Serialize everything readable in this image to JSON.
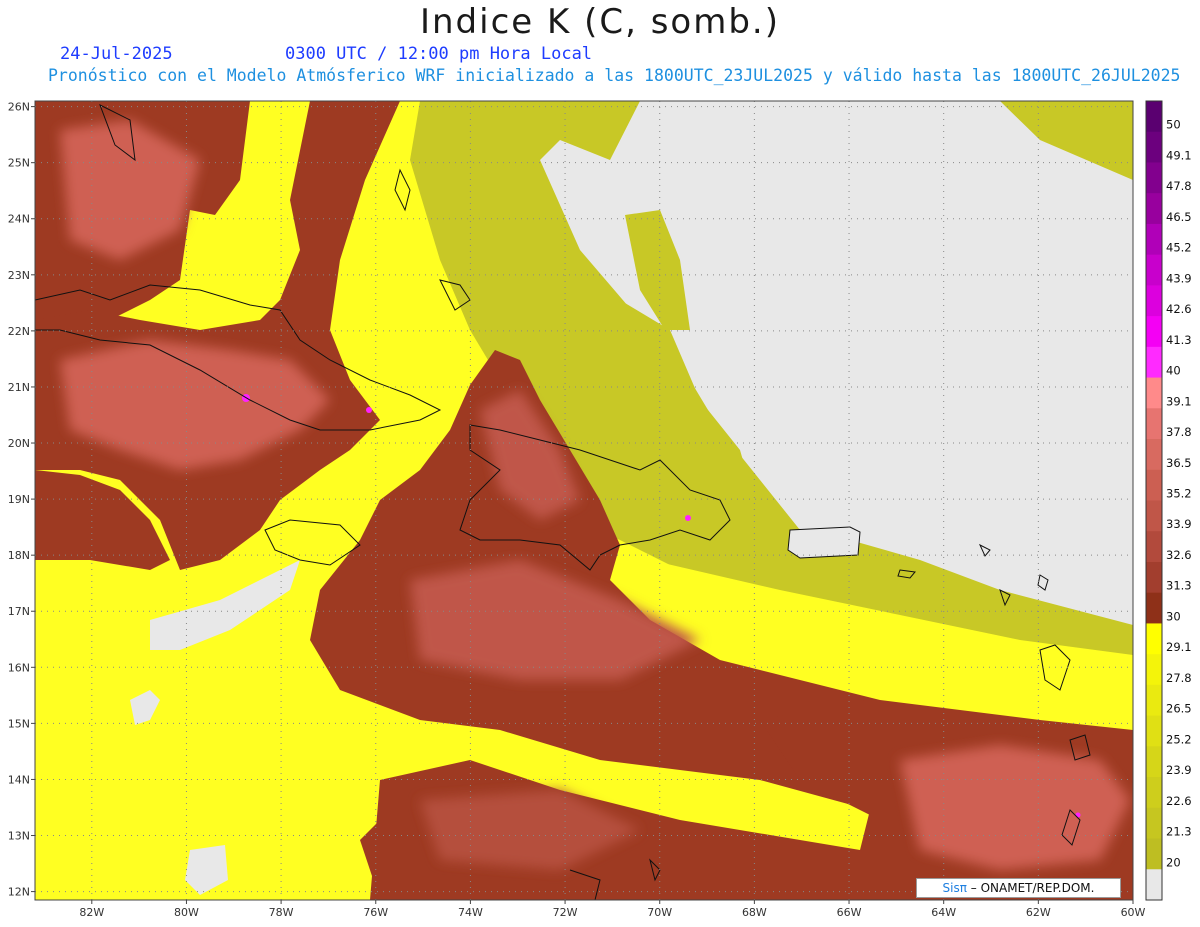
{
  "header": {
    "title": "Indice K (C, somb.)",
    "date": "24-Jul-2025",
    "time": "0300 UTC / 12:00 pm Hora Local",
    "subtitle": "Pronóstico con el Modelo Atmósferico WRF inicializado a las 1800UTC_23JUL2025 y válido hasta las  1800UTC_26JUL2025"
  },
  "map": {
    "lon_range": [
      -83.2,
      -60
    ],
    "lat_range": [
      11.85,
      26.1
    ],
    "lat_ticks": [
      {
        "value": 26,
        "label": "26N"
      },
      {
        "value": 25,
        "label": "25N"
      },
      {
        "value": 24,
        "label": "24N"
      },
      {
        "value": 23,
        "label": "23N"
      },
      {
        "value": 22,
        "label": "22N"
      },
      {
        "value": 21,
        "label": "21N"
      },
      {
        "value": 20,
        "label": "20N"
      },
      {
        "value": 19,
        "label": "19N"
      },
      {
        "value": 18,
        "label": "18N"
      },
      {
        "value": 17,
        "label": "17N"
      },
      {
        "value": 16,
        "label": "16N"
      },
      {
        "value": 15,
        "label": "15N"
      },
      {
        "value": 14,
        "label": "14N"
      },
      {
        "value": 13,
        "label": "13N"
      },
      {
        "value": 12,
        "label": "12N"
      }
    ],
    "lon_ticks": [
      {
        "value": -82,
        "label": "82W"
      },
      {
        "value": -80,
        "label": "80W"
      },
      {
        "value": -78,
        "label": "78W"
      },
      {
        "value": -76,
        "label": "76W"
      },
      {
        "value": -74,
        "label": "74W"
      },
      {
        "value": -72,
        "label": "72W"
      },
      {
        "value": -70,
        "label": "70W"
      },
      {
        "value": -68,
        "label": "68W"
      },
      {
        "value": -66,
        "label": "66W"
      },
      {
        "value": -64,
        "label": "64W"
      },
      {
        "value": -62,
        "label": "62W"
      },
      {
        "value": -60,
        "label": "60W"
      }
    ],
    "colors": {
      "no_data": "#e8e8e8",
      "yellow": "#ffff22",
      "olive": "#c8c826",
      "brown_dark": "#9e3a22",
      "brown_mid": "#b5503c",
      "salmon": "#d76a5c",
      "magenta": "#ff22ff",
      "coast": "#111111"
    }
  },
  "colorbar": {
    "levels": [
      {
        "label": "50",
        "color": "#5a0070"
      },
      {
        "label": "49.1",
        "color": "#6c007e"
      },
      {
        "label": "47.8",
        "color": "#82008e"
      },
      {
        "label": "46.5",
        "color": "#98009e"
      },
      {
        "label": "45.2",
        "color": "#b000b8"
      },
      {
        "label": "43.9",
        "color": "#c800cc"
      },
      {
        "label": "42.6",
        "color": "#dc00de"
      },
      {
        "label": "41.3",
        "color": "#f400f4"
      },
      {
        "label": "40",
        "color": "#ff2aff"
      },
      {
        "label": "39.1",
        "color": "#ff8a8a"
      },
      {
        "label": "37.8",
        "color": "#e77470"
      },
      {
        "label": "36.5",
        "color": "#d86a60"
      },
      {
        "label": "35.2",
        "color": "#cc5f52"
      },
      {
        "label": "33.9",
        "color": "#c05648"
      },
      {
        "label": "32.6",
        "color": "#b24a3c"
      },
      {
        "label": "31.3",
        "color": "#a23e2e"
      },
      {
        "label": "30",
        "color": "#8e3018"
      },
      {
        "label": "29.1",
        "color": "#ffff00"
      },
      {
        "label": "27.8",
        "color": "#f4f40a"
      },
      {
        "label": "26.5",
        "color": "#eaea10"
      },
      {
        "label": "25.2",
        "color": "#e0e014"
      },
      {
        "label": "23.9",
        "color": "#d6d618"
      },
      {
        "label": "22.6",
        "color": "#cece1c"
      },
      {
        "label": "21.3",
        "color": "#c6c620"
      },
      {
        "label": "20",
        "color": "#bebe22"
      },
      {
        "label": "",
        "color": "#e8e8e8"
      }
    ]
  },
  "credit": {
    "brand": "Sisπ",
    "text": "– ONAMET/REP.DOM."
  }
}
